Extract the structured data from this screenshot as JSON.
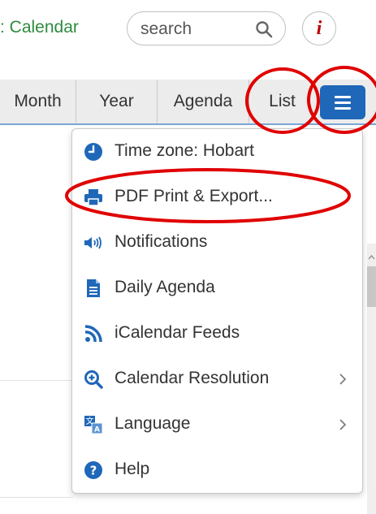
{
  "header": {
    "calendar_link": ": Calendar",
    "search_placeholder": "search",
    "search_icon": "search-icon",
    "info_label": "i"
  },
  "toolbar": {
    "views": [
      "Month",
      "Year",
      "Agenda",
      "List"
    ],
    "menu_icon": "hamburger-icon"
  },
  "menu": {
    "items": [
      {
        "label": "Time zone: Hobart",
        "icon": "clock-icon"
      },
      {
        "label": "PDF Print & Export...",
        "icon": "printer-icon"
      },
      {
        "label": "Notifications",
        "icon": "speaker-icon"
      },
      {
        "label": "Daily Agenda",
        "icon": "document-icon"
      },
      {
        "label": "iCalendar Feeds",
        "icon": "rss-icon"
      },
      {
        "label": "Calendar Resolution",
        "icon": "zoom-in-icon",
        "submenu": true
      },
      {
        "label": "Language",
        "icon": "translate-icon",
        "submenu": true
      },
      {
        "label": "Help",
        "icon": "help-icon"
      }
    ]
  },
  "colors": {
    "accent": "#1f67b8",
    "link": "#2e8b3e",
    "annotation": "#e00000",
    "info": "#c00000"
  }
}
